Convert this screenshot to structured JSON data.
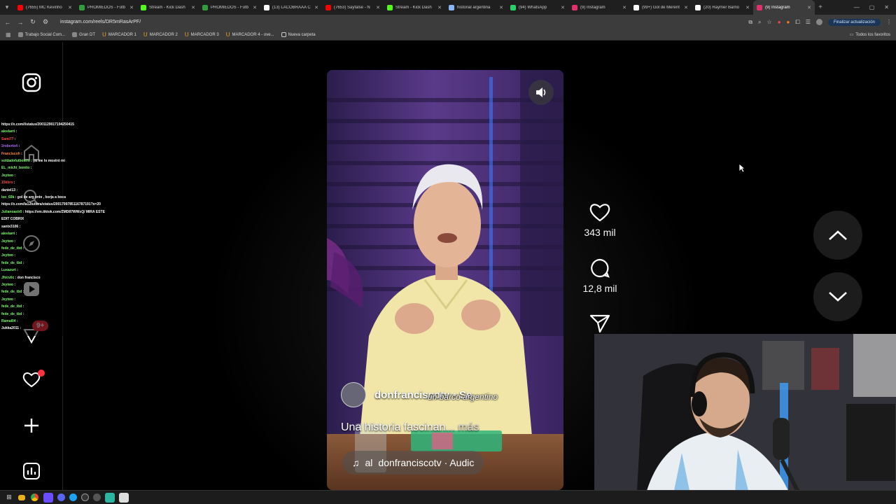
{
  "browser": {
    "tabs": [
      {
        "title": "(7655) MC Kevinho",
        "color": "#ff0000"
      },
      {
        "title": "PROMIEDOS - Fútb",
        "color": "#2e9e3e"
      },
      {
        "title": "Stream - Kick Dash",
        "color": "#53fc18"
      },
      {
        "title": "PROMIEDOS - Fútb",
        "color": "#2e9e3e"
      },
      {
        "title": "(13) LACOBRAAA C",
        "color": "#ffffff"
      },
      {
        "title": "(7653) Sayfalse - N",
        "color": "#ff0000"
      },
      {
        "title": "Stream - Kick Dash",
        "color": "#53fc18"
      },
      {
        "title": "historial argentina",
        "color": "#8ab4f8"
      },
      {
        "title": "(94) WhatsApp",
        "color": "#25d366"
      },
      {
        "title": "(9) Instagram",
        "color": "#e1306c"
      },
      {
        "title": "(99+) Gol de Merent",
        "color": "#ffffff"
      },
      {
        "title": "(20) Raymer Barrio",
        "color": "#ffffff"
      },
      {
        "title": "(9) Instagram",
        "color": "#e1306c"
      }
    ],
    "url": "instagram.com/reels/DR5mRasArPF/",
    "update_label": "Finalizar actualización",
    "bookmarks": [
      {
        "label": "Trabajo Social Com...",
        "icon": "doc-icon"
      },
      {
        "label": "Gran DT",
        "icon": "ball-icon"
      },
      {
        "label": "MARCADOR 1",
        "icon": "horseshoe-icon"
      },
      {
        "label": "MARCADOR 2",
        "icon": "horseshoe-icon"
      },
      {
        "label": "MARCADOR 3",
        "icon": "horseshoe-icon"
      },
      {
        "label": "MARCADOR 4 - ove...",
        "icon": "horseshoe-icon"
      },
      {
        "label": "Nueva carpeta",
        "icon": "folder-icon"
      }
    ],
    "all_bookmarks_label": "Todos los favoritos"
  },
  "chat": [
    {
      "user": "",
      "text": "https://x.com/i/status/2001129017194250415",
      "color": "#ffffff"
    },
    {
      "user": "aleelarri",
      "text": ":",
      "color": "#7cff6b"
    },
    {
      "user": "Sami77",
      "text": ":",
      "color": "#ff4d4d"
    },
    {
      "user": "2roberto4",
      "text": ":",
      "color": "#b06bff"
    },
    {
      "user": "Franciscoh",
      "text": ":",
      "color": "#ff8a3d"
    },
    {
      "user": "soldadofutbolero",
      "text": ": ya me lo mostró mi",
      "color": "#7cff6b"
    },
    {
      "user": "EL_michi_bonito",
      "text": ":",
      "color": "#7cff6b"
    },
    {
      "user": "Jeytwo",
      "text": ":",
      "color": "#7cff6b"
    },
    {
      "user": "15kbro",
      "text": ":",
      "color": "#ff4d4d"
    },
    {
      "user": "daniel13",
      "text": ":",
      "color": "#ffffff"
    },
    {
      "user": "leo_69k",
      "text": ": gol de arg ente , borja a boca",
      "color": "#7cff6b"
    },
    {
      "user": "",
      "text": "https://x.com/la12tuitera/status/2001799785116787191?s=20",
      "color": "#ffffff"
    },
    {
      "user": "Julianoastr0",
      "text": ": https://vm.tiktok.com/ZMD87WWxQ/ MIRA ESTE",
      "color": "#7cff6b"
    },
    {
      "user": "",
      "text": "EDIT COBRIX",
      "color": "#ffffff"
    },
    {
      "user": "santx3106",
      "text": ":",
      "color": "#ffffff"
    },
    {
      "user": "aleelarri",
      "text": ":",
      "color": "#7cff6b"
    },
    {
      "user": "Jeytwo",
      "text": ":",
      "color": "#7cff6b"
    },
    {
      "user": "fede_de_tbd",
      "text": ":",
      "color": "#7cff6b"
    },
    {
      "user": "Jeytwo",
      "text": ":",
      "color": "#7cff6b"
    },
    {
      "user": "fede_de_tbd",
      "text": ":",
      "color": "#7cff6b"
    },
    {
      "user": "Luxazurt",
      "text": ":",
      "color": "#7cff6b"
    },
    {
      "user": "Jhicvilc",
      "text": ": don francisco",
      "color": "#7cff6b"
    },
    {
      "user": "Jeytwo",
      "text": ":",
      "color": "#7cff6b"
    },
    {
      "user": "fede_de_tbd",
      "text": ":",
      "color": "#7cff6b"
    },
    {
      "user": "Jeytwo",
      "text": ":",
      "color": "#7cff6b"
    },
    {
      "user": "fede_de_tbd",
      "text": ":",
      "color": "#7cff6b"
    },
    {
      "user": "fede_de_tbd",
      "text": ":",
      "color": "#7cff6b"
    },
    {
      "user": "Ramal04",
      "text": ":",
      "color": "#7cff6b"
    },
    {
      "user": "Jukka2011",
      "text": ":",
      "color": "#ffffff"
    }
  ],
  "sidebar": {
    "notification_count": "9+"
  },
  "reel": {
    "username": "donfranciscotv",
    "follow_hint": "• Se",
    "subtitle": "un barco argentino",
    "caption": "Una historia fascinan",
    "more_label": "... más",
    "audio_prefix": "al",
    "audio_label": "donfranciscotv · Audic"
  },
  "actions": {
    "likes": "343 mil",
    "comments": "12,8 mil"
  },
  "colors": {
    "accent": "#ff3040",
    "background": "#000000"
  }
}
